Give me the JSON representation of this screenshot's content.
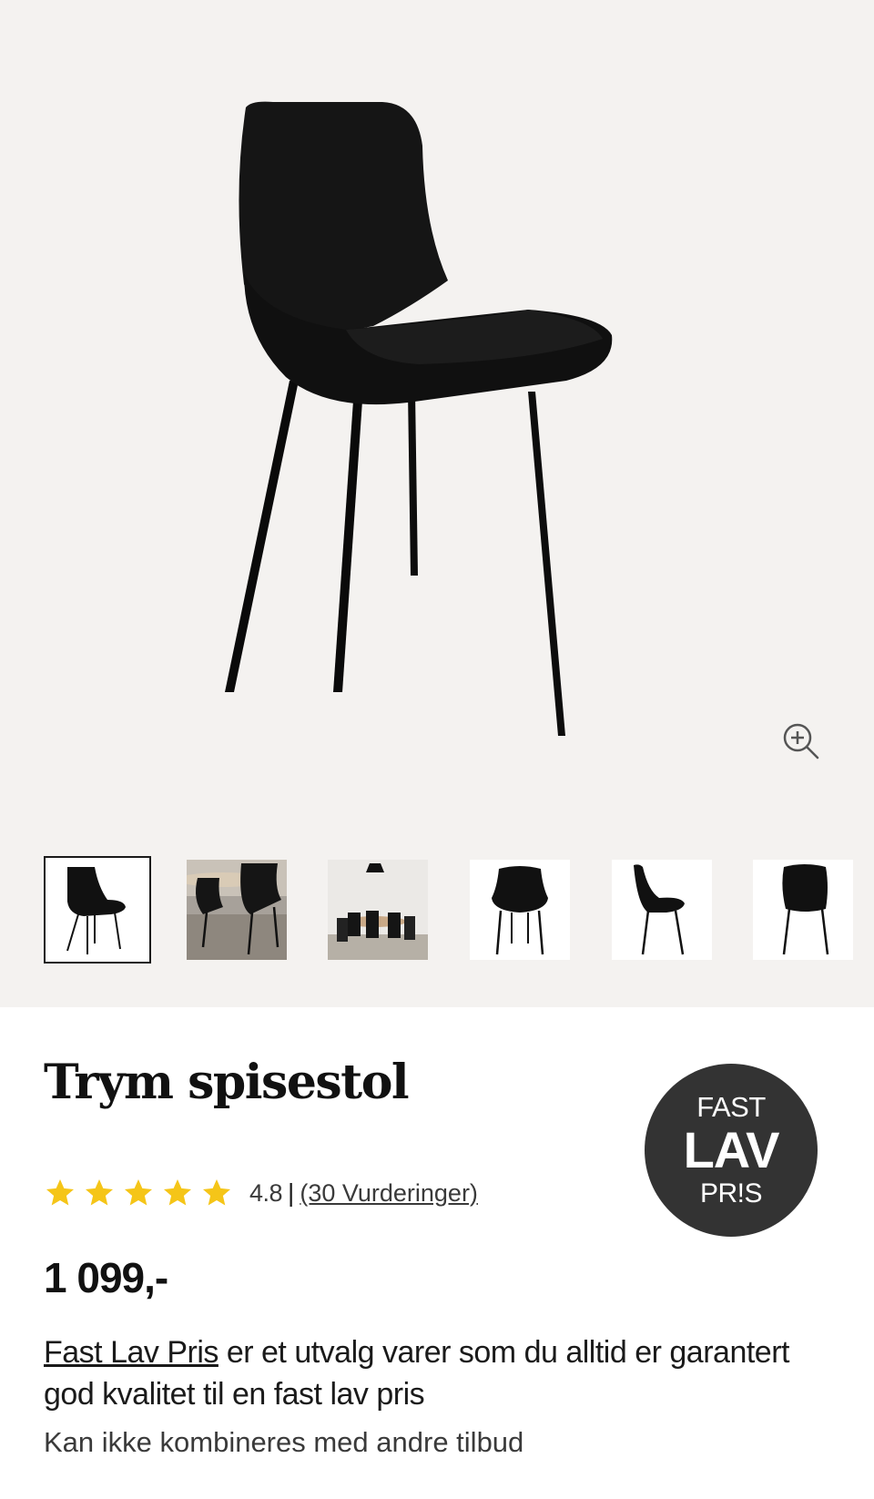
{
  "product": {
    "title": "Trym spisestol",
    "rating_score": "4.8",
    "rating_separator": "|",
    "rating_count_label": "(30 Vurderinger)",
    "rating_stars": 5,
    "price": "1 099,-"
  },
  "badge": {
    "line1": "FAST",
    "line2": "LAV",
    "line3": "PR!S"
  },
  "info": {
    "link_label": "Fast Lav Pris",
    "description_rest": " er et utvalg varer som du alltid er garantert god kvalitet til en fast lav pris",
    "note": "Kan ikke kombineres med andre tilbud"
  },
  "gallery": {
    "thumbnail_count": 6,
    "selected_index": 0
  },
  "colors": {
    "gallery_bg": "#f4f2f0",
    "star": "#f5c518",
    "badge_bg": "#333333",
    "text": "#1a1a1a"
  },
  "icons": {
    "zoom": "zoom-in-icon",
    "star": "star-icon"
  }
}
